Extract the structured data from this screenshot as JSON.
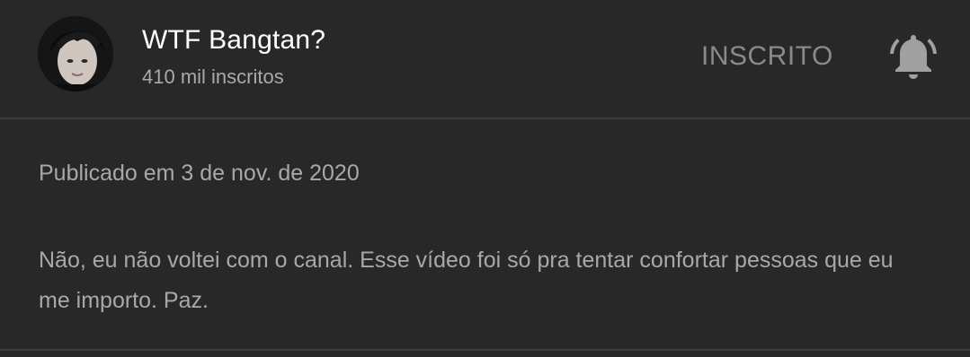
{
  "channel": {
    "name": "WTF Bangtan?",
    "subscribers": "410 mil inscritos",
    "subscribe_label": "INSCRITO",
    "bell_icon": "bell-icon"
  },
  "description": {
    "published": "Publicado em 3 de nov. de 2020",
    "text": "Não, eu não voltei com o canal. Esse vídeo foi só pra tentar confortar pessoas que eu me importo. Paz."
  },
  "colors": {
    "background": "#282828",
    "divider": "#3d3d3d",
    "title": "#ffffff",
    "secondary_text": "#aaaaaa",
    "subscribed_button": "#8a8a8a",
    "bell": "#a0a0a0"
  }
}
